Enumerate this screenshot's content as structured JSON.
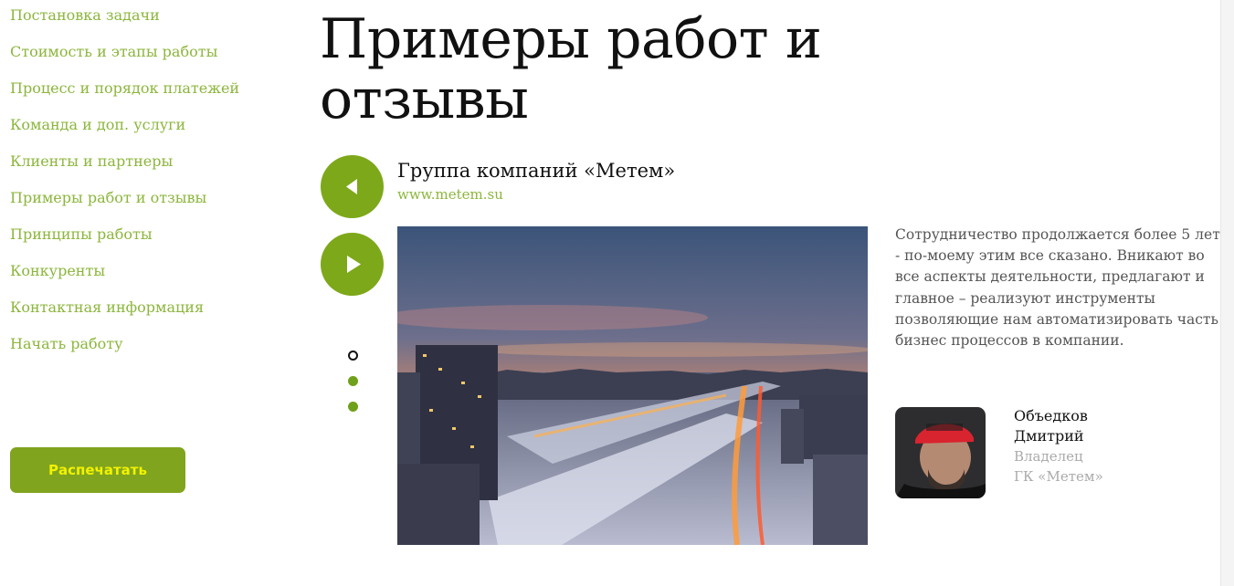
{
  "sidebar": {
    "nav_items": [
      "Постановка задачи",
      "Стоимость и этапы работы",
      "Процесс и порядок платежей",
      "Команда и доп. услуги",
      "Клиенты и партнеры",
      "Примеры работ и отзывы",
      "Принципы работы",
      "Конкуренты",
      "Контактная информация",
      "Начать работу"
    ],
    "print_label": "Распечатать"
  },
  "main": {
    "title": "Примеры работ и отзывы",
    "company": {
      "name": "Группа компаний «Метем»",
      "link": "www.metem.su"
    },
    "slider": {
      "prev_icon": "arrow-left-icon",
      "next_icon": "arrow-right-icon",
      "active_index": 0,
      "dots": 3
    },
    "review": {
      "text": "Сотрудничество продолжается более 5 лет - по-моему этим все сказано. Вникают во все аспекты деятельности, предлагают и главное – реализуют инструменты позволяющие нам автоматизировать часть бизнес процессов в компании."
    },
    "person": {
      "name_line1": "Объедков",
      "name_line2": "Дмитрий",
      "role_line1": "Владелец",
      "role_line2": "ГК «Метем»"
    }
  },
  "colors": {
    "accent": "#8cb63c",
    "button_bg": "#80a41e",
    "button_text": "#f2f200",
    "circle_bg": "#7da81a"
  }
}
